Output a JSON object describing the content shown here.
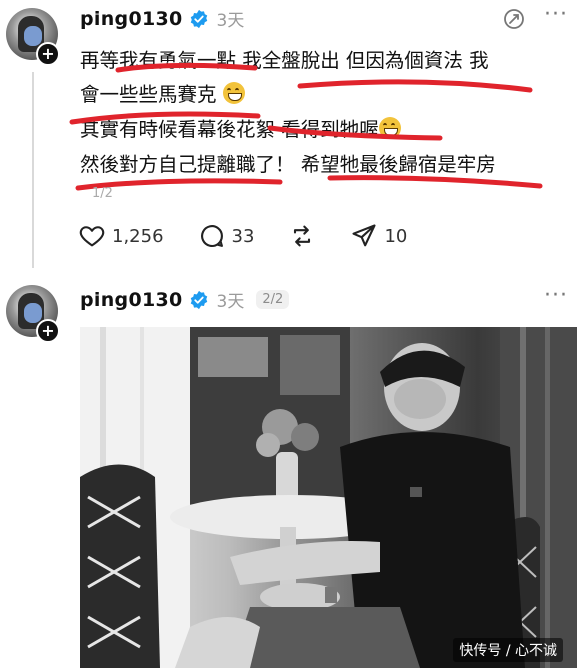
{
  "posts": [
    {
      "username": "ping0130",
      "time": "3天",
      "lines": [
        "再等我有勇氣一點 我全盤脫出 但因為個資法 我",
        "會一些些馬賽克",
        "其實有時候看幕後花絮 看得到牠喔",
        "然後對方自己提離職了！ 希望牠最後歸宿是牢房"
      ],
      "counter": "1/2",
      "actions": {
        "likes": "1,256",
        "comments": "33",
        "shares": "10"
      }
    },
    {
      "username": "ping0130",
      "time": "3天",
      "page": "2/2"
    }
  ],
  "watermark": "快传号 / 心不诚",
  "icons": [
    "verified-badge-icon",
    "repost-icon",
    "more-icon",
    "heart-icon",
    "comment-icon",
    "share-icon",
    "plus-icon"
  ],
  "colors": {
    "accent": "#1d9bf0",
    "annotation": "#e0242c",
    "muted": "#9a9a9a"
  }
}
